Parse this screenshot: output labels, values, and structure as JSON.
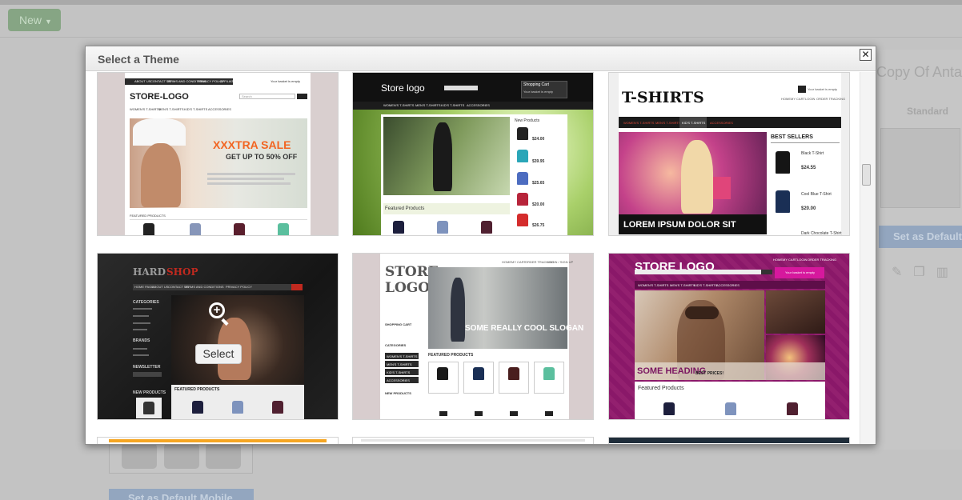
{
  "background": {
    "new_button": "New",
    "theme_title": "Copy Of Antar",
    "tab_label": "Standard",
    "default_button": "Set as Default",
    "mobile_button": "Set as Default Mobile"
  },
  "modal": {
    "title": "Select a Theme",
    "close_label": "✕"
  },
  "themes": [
    {
      "logo": "STORE-LOGO",
      "nav": [
        "ABOUT US",
        "CONTACT US",
        "TERMS AND CONDITIONS",
        "PRIVACY POLICY",
        "AFFILIATE"
      ],
      "menu": [
        "WOMEN'S T-SHIRTS",
        "MEN'S T-SHIRTS",
        "KID'S T-SHIRTS",
        "ACCESSORIES"
      ],
      "banner_line1": "XXXTRA SALE",
      "banner_line2": "GET UP TO 50% OFF",
      "search": "Search",
      "basket": "Your basket is empty",
      "section": "FEATURED PRODUCTS"
    },
    {
      "logo": "Store logo",
      "menu": [
        "WOMEN'S T-SHIRTS",
        "MEN'S T-SHIRTS",
        "KID'S T-SHIRTS",
        "ACCESSORIES"
      ],
      "cart": "Shopping Cart",
      "cart_sub": "Your basket is empty",
      "sidebar_title": "New Products",
      "prices": [
        "$24.00",
        "$39.95",
        "$25.65",
        "$20.00",
        "$26.75"
      ],
      "section": "Featured Products"
    },
    {
      "logo": "T-SHIRTS",
      "basket": "Your basket is empty",
      "top_links": [
        "HOME",
        "MY CART",
        "LOGIN",
        "ORDER TRACKING"
      ],
      "menu": [
        "WOMEN'S T-SHIRTS",
        "MEN'S T-SHIRTS",
        "KID'S T-SHIRTS",
        "ACCESSORIES"
      ],
      "banner": "LOREM IPSUM DOLOR SIT",
      "sidebar_title": "BEST SELLERS",
      "items": [
        {
          "name": "Black T-Shirt",
          "price": "$24.55"
        },
        {
          "name": "Cool Blue T-Shirt",
          "price": "$20.00"
        },
        {
          "name": "Dark Chocolate T-Shirt",
          "price": ""
        }
      ]
    },
    {
      "logo_a": "HARD",
      "logo_b": "SHOP",
      "menu": [
        "HOME PAGE",
        "ABOUT US",
        "CONTACT US",
        "TERMS AND CONDITIONS",
        "PRIVACY POLICY"
      ],
      "side_sections": [
        "CATEGORIES",
        "BRANDS",
        "NEWSLETTER",
        "NEW PRODUCTS"
      ],
      "section": "FEATURED PRODUCTS",
      "select_label": "Select"
    },
    {
      "logo_a": "STORE",
      "logo_b": "LOGO",
      "top_links": [
        "HOME",
        "MY CART",
        "ORDER TRACKING",
        "LOGIN / SIGN UP"
      ],
      "banner": "SOME REALLY COOL SLOGAN",
      "side": [
        "SHOPPING CART",
        "CATEGORIES",
        "NEW PRODUCTS"
      ],
      "categories": [
        "WOMEN'S T-SHIRTS",
        "MEN'S T-SHIRTS",
        "KID'S T-SHIRTS",
        "ACCESSORIES"
      ],
      "section": "FEATURED PRODUCTS"
    },
    {
      "logo": "STORE LOGO",
      "top_links": [
        "HOME",
        "MY CART",
        "LOGIN",
        "ORDER TRACKING"
      ],
      "menu": [
        "WOMEN'S T-SHIRTS",
        "MEN'S T-SHIRTS",
        "KID'S T-SHIRTS",
        "ACCESSORIES"
      ],
      "basket": "Your basket is empty",
      "banner": "SOME HEADING",
      "banner_sub": "BEST PRICES!",
      "section": "Featured Products"
    }
  ],
  "colors": {
    "accent_orange": "#f26522",
    "magenta": "#8e1a6d",
    "dark": "#1d1d1d"
  }
}
